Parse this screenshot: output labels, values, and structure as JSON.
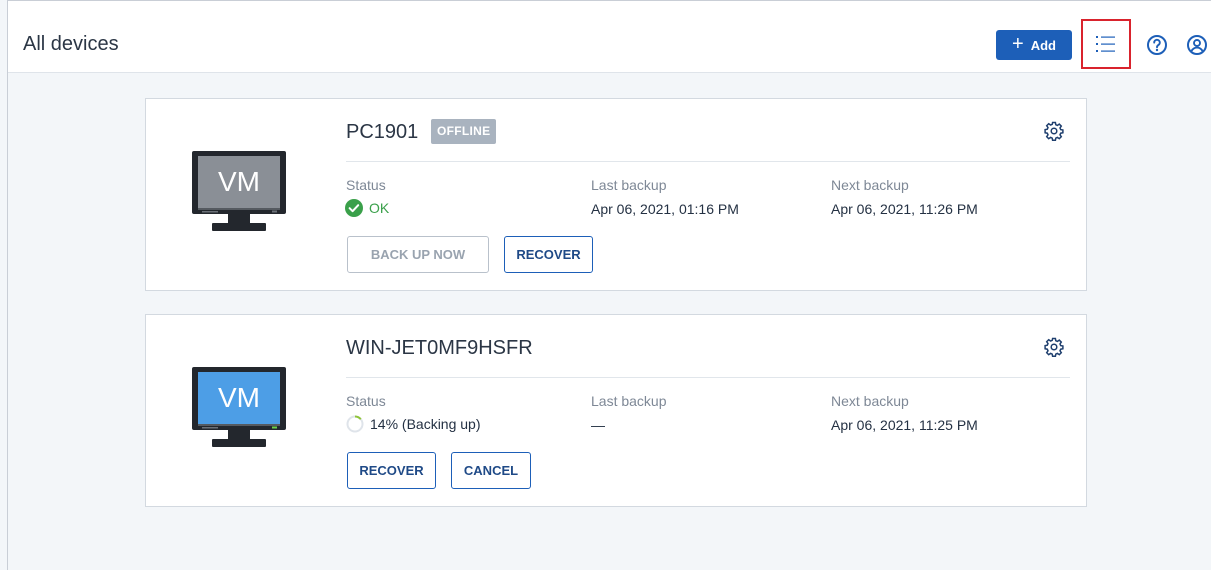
{
  "header": {
    "title": "All devices",
    "add_label": "Add"
  },
  "icons": {
    "add": "plus-icon",
    "list_view": "list-view-icon",
    "help": "help-icon",
    "account": "account-icon",
    "settings": "gear-icon",
    "device": "vm-monitor-icon"
  },
  "colors": {
    "accent": "#1d5fb8",
    "highlight_box": "#d9232d",
    "status_ok": "#3aa04a",
    "offline_badge": "#a9b3bf",
    "vm_offline_screen": "#8a8f96",
    "vm_online_screen": "#4d9ee6"
  },
  "devices": [
    {
      "name": "PC1901",
      "badge": "OFFLINE",
      "vm_label": "VM",
      "status_label": "Status",
      "status_value": "OK",
      "last_backup_label": "Last backup",
      "last_backup_value": "Apr 06, 2021, 01:16 PM",
      "next_backup_label": "Next backup",
      "next_backup_value": "Apr 06, 2021, 11:26 PM",
      "buttons": [
        "BACK UP NOW",
        "RECOVER"
      ]
    },
    {
      "name": "WIN-JET0MF9HSFR",
      "vm_label": "VM",
      "status_label": "Status",
      "status_value": "14% (Backing up)",
      "progress": 0.14,
      "last_backup_label": "Last backup",
      "last_backup_value": "—",
      "next_backup_label": "Next backup",
      "next_backup_value": "Apr 06, 2021, 11:25 PM",
      "buttons": [
        "RECOVER",
        "CANCEL"
      ]
    }
  ]
}
